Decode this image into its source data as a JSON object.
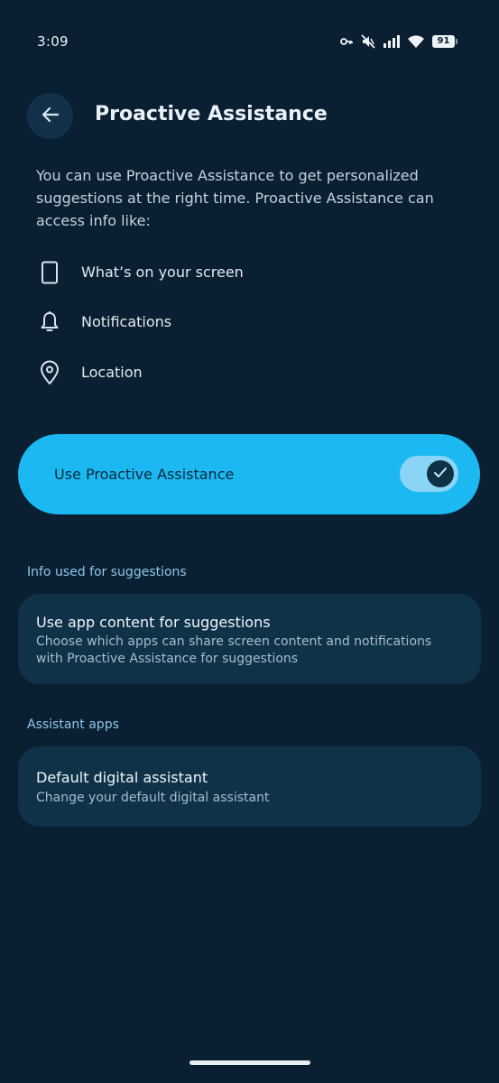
{
  "status_bar": {
    "time": "3:09",
    "battery_level": "91",
    "icons": [
      "key-icon",
      "mute-icon",
      "signal-icon",
      "wifi-icon",
      "battery-icon"
    ]
  },
  "header": {
    "title": "Proactive Assistance",
    "back_icon": "arrow-left-icon"
  },
  "intro_text": "You can use Proactive Assistance to get personalized suggestions at the right time. Proactive Assistance can access info like:",
  "info_items": [
    {
      "label": "What’s on your screen",
      "icon": "phone-outline-icon"
    },
    {
      "label": "Notifications",
      "icon": "bell-icon"
    },
    {
      "label": "Location",
      "icon": "location-pin-icon"
    }
  ],
  "main_toggle": {
    "label": "Use Proactive Assistance",
    "enabled": true
  },
  "sections": [
    {
      "header": "Info used for suggestions",
      "item": {
        "title": "Use app content for suggestions",
        "subtitle": "Choose which apps can share screen content and notifications with Proactive Assistance for suggestions"
      }
    },
    {
      "header": "Assistant apps",
      "item": {
        "title": "Default digital assistant",
        "subtitle": "Change your default digital assistant"
      }
    }
  ],
  "colors": {
    "background": "#0a1f31",
    "accent": "#1bb8f2",
    "card": "#0f3249",
    "section_header": "#8fc8ea"
  }
}
